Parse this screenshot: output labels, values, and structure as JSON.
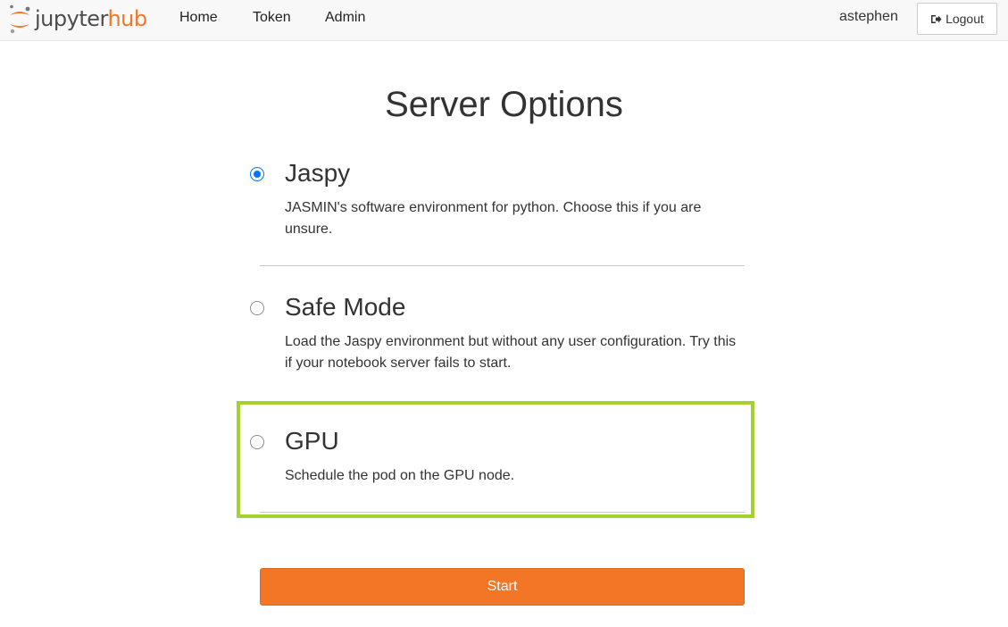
{
  "brand": {
    "part1": "jupyter",
    "part2": "hub"
  },
  "nav": {
    "links": [
      "Home",
      "Token",
      "Admin"
    ],
    "user": "astephen",
    "logout_label": "Logout"
  },
  "page": {
    "title": "Server Options"
  },
  "options": [
    {
      "title": "Jaspy",
      "desc": "JASMIN's software environment for python. Choose this if you are unsure.",
      "selected": true
    },
    {
      "title": "Safe Mode",
      "desc": "Load the Jaspy environment but without any user configuration. Try this if your notebook server fails to start.",
      "selected": false
    },
    {
      "title": "GPU",
      "desc": "Schedule the pod on the GPU node.",
      "selected": false
    }
  ],
  "start_label": "Start",
  "colors": {
    "accent": "#f37626",
    "highlight": "#a4d22d",
    "radio": "#0075ff"
  }
}
